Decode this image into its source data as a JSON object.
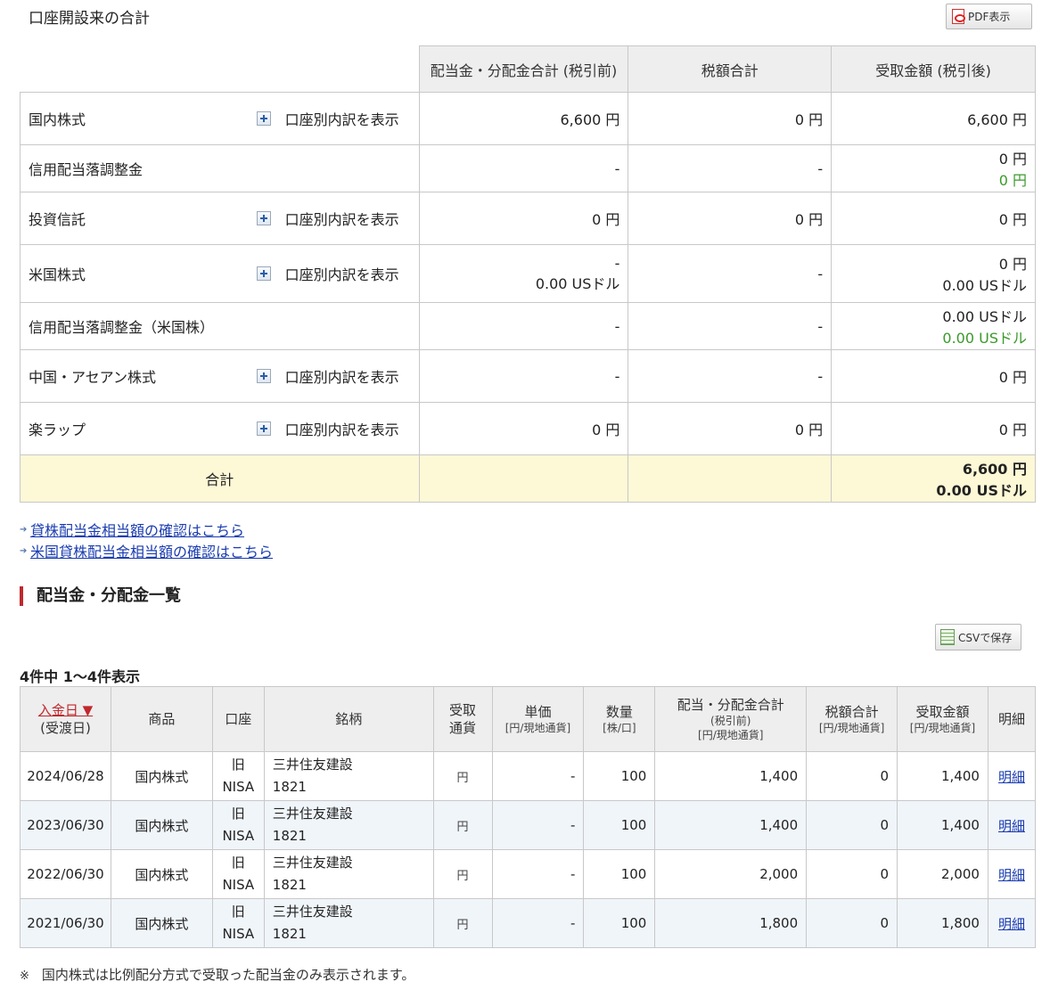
{
  "page_title": "口座開設来の合計",
  "pdf_button": "PDF表示",
  "summary": {
    "headers": [
      "配当金・分配金合計 (税引前)",
      "税額合計",
      "受取金額 (税引後)"
    ],
    "expand_label": "口座別内訳を表示",
    "rows": [
      {
        "label": "国内株式",
        "pre": [
          "6,600 円"
        ],
        "tax": [
          "0 円"
        ],
        "net": [
          "6,600 円"
        ],
        "net_green": []
      },
      {
        "label": "信用配当落調整金",
        "pre": [
          "-"
        ],
        "tax": [
          "-"
        ],
        "net": [
          "0 円"
        ],
        "net_green": [
          "0 円"
        ]
      },
      {
        "label": "投資信託",
        "pre": [
          "0 円"
        ],
        "tax": [
          "0 円"
        ],
        "net": [
          "0 円"
        ],
        "net_green": []
      },
      {
        "label": "米国株式",
        "pre": [
          "-",
          "0.00 USドル"
        ],
        "tax": [
          "-"
        ],
        "net": [
          "0 円",
          "0.00 USドル"
        ],
        "net_green": []
      },
      {
        "label": "信用配当落調整金（米国株）",
        "pre": [
          "-"
        ],
        "tax": [
          "-"
        ],
        "net": [
          "0.00 USドル"
        ],
        "net_green": [
          "0.00 USドル"
        ]
      },
      {
        "label": "中国・アセアン株式",
        "pre": [
          "-"
        ],
        "tax": [
          "-"
        ],
        "net": [
          "0 円"
        ],
        "net_green": []
      },
      {
        "label": "楽ラップ",
        "pre": [
          "0 円"
        ],
        "tax": [
          "0 円"
        ],
        "net": [
          "0 円"
        ],
        "net_green": []
      }
    ],
    "total": {
      "label": "合計",
      "net": [
        "6,600 円",
        "0.00 USドル"
      ]
    }
  },
  "links": [
    "貸株配当金相当額の確認はこちら",
    "米国貸株配当金相当額の確認はこちら"
  ],
  "section_title": "配当金・分配金一覧",
  "csv_button": "CSVで保存",
  "count_text": "4件中 1〜4件表示",
  "list": {
    "headers": {
      "date": "入金日 ▼",
      "date_sub": "(受渡日)",
      "product": "商品",
      "account": "口座",
      "name": "銘柄",
      "currency1": "受取",
      "currency2": "通貨",
      "price": "単価",
      "price_sub": "[円/現地通貨]",
      "qty": "数量",
      "qty_sub": "[株/口]",
      "total": "配当・分配金合計",
      "total_sub1": "(税引前)",
      "total_sub2": "[円/現地通貨]",
      "tax": "税額合計",
      "tax_sub": "[円/現地通貨]",
      "net": "受取金額",
      "net_sub": "[円/現地通貨]",
      "detail": "明細"
    },
    "rows": [
      {
        "date": "2024/06/28",
        "product": "国内株式",
        "acct1": "旧",
        "acct2": "NISA",
        "name": "三井住友建設",
        "code": "1821",
        "currency": "円",
        "price": "-",
        "qty": "100",
        "total": "1,400",
        "tax": "0",
        "net": "1,400",
        "detail": "明細"
      },
      {
        "date": "2023/06/30",
        "product": "国内株式",
        "acct1": "旧",
        "acct2": "NISA",
        "name": "三井住友建設",
        "code": "1821",
        "currency": "円",
        "price": "-",
        "qty": "100",
        "total": "1,400",
        "tax": "0",
        "net": "1,400",
        "detail": "明細"
      },
      {
        "date": "2022/06/30",
        "product": "国内株式",
        "acct1": "旧",
        "acct2": "NISA",
        "name": "三井住友建設",
        "code": "1821",
        "currency": "円",
        "price": "-",
        "qty": "100",
        "total": "2,000",
        "tax": "0",
        "net": "2,000",
        "detail": "明細"
      },
      {
        "date": "2021/06/30",
        "product": "国内株式",
        "acct1": "旧",
        "acct2": "NISA",
        "name": "三井住友建設",
        "code": "1821",
        "currency": "円",
        "price": "-",
        "qty": "100",
        "total": "1,800",
        "tax": "0",
        "net": "1,800",
        "detail": "明細"
      }
    ]
  },
  "note_mark": "※",
  "note": "国内株式は比例配分方式で受取った配当金のみ表示されます。"
}
